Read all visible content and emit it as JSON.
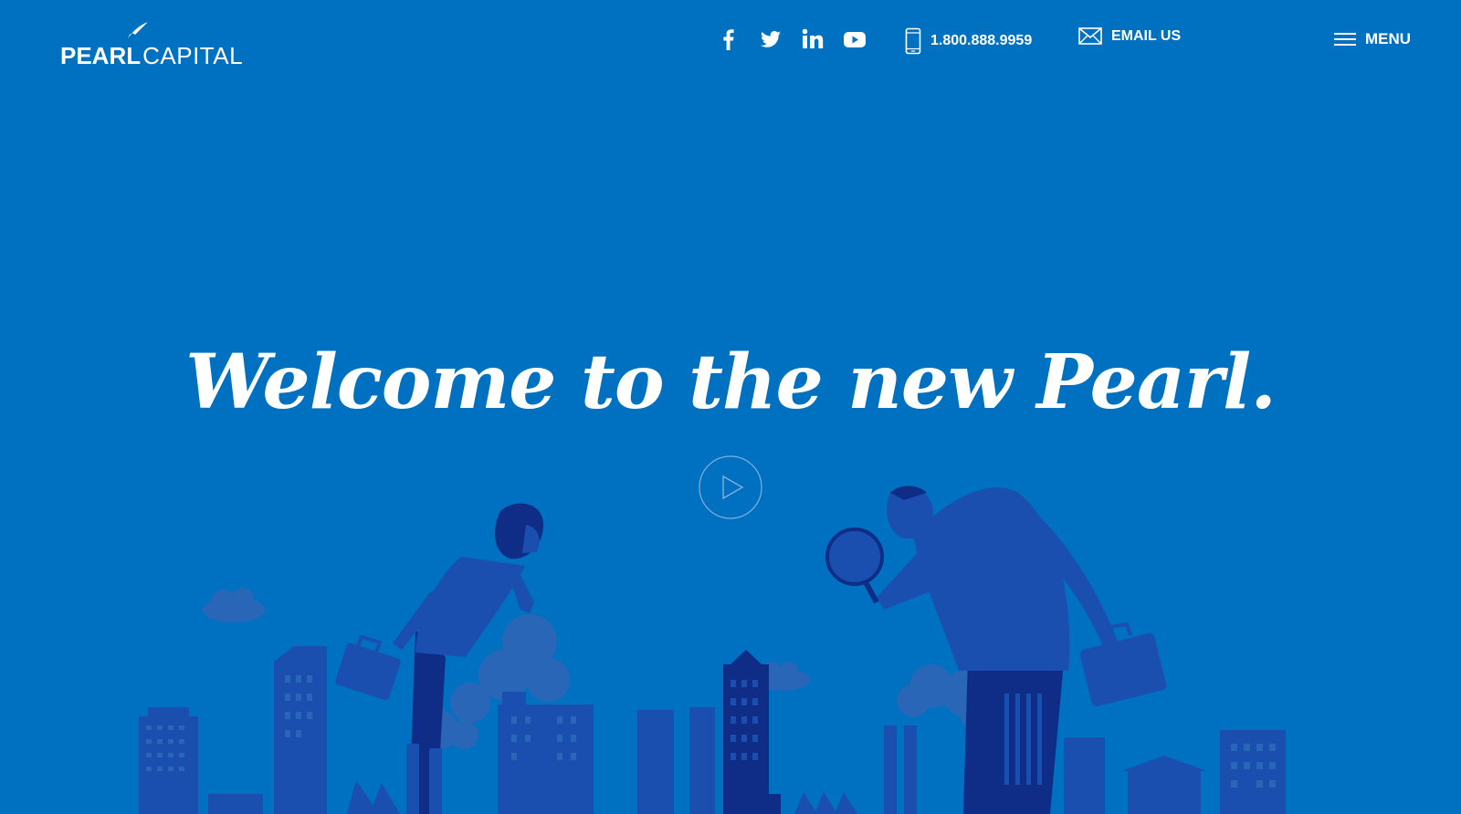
{
  "brand": {
    "name_bold": "PEARL",
    "name_light": "CAPITAL"
  },
  "social": [
    {
      "name": "facebook-icon"
    },
    {
      "name": "twitter-icon"
    },
    {
      "name": "linkedin-icon"
    },
    {
      "name": "youtube-icon"
    }
  ],
  "contact": {
    "phone": "1.800.888.9959",
    "email_label": "EMAIL US"
  },
  "menu": {
    "label": "MENU"
  },
  "hero": {
    "headline": "Welcome to the new Pearl."
  },
  "colors": {
    "background": "#0071c1",
    "illustration_mid": "#1a4fb0",
    "illustration_dark": "#0f2d86",
    "cloud": "#2a66b8",
    "text": "#ffffff"
  }
}
